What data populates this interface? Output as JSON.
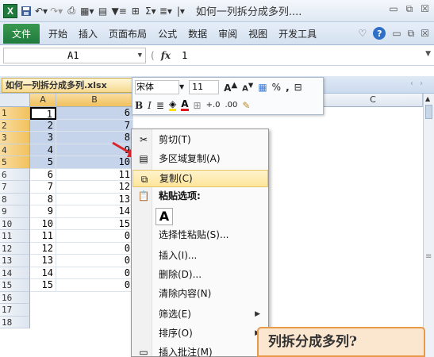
{
  "titlebar": {
    "app_icon": "X",
    "title": "如何一列拆分成多列...."
  },
  "ribbon": {
    "file_tab": "文件",
    "tabs": [
      "开始",
      "插入",
      "页面布局",
      "公式",
      "数据",
      "审阅",
      "视图",
      "开发工具"
    ]
  },
  "formulabar": {
    "namebox": "A1",
    "fx_label": "fx",
    "value": "1"
  },
  "workbook": {
    "tab_name": "如何一列拆分成多列.xlsx"
  },
  "grid": {
    "columns": [
      "A",
      "B",
      "C"
    ],
    "rows": [
      "1",
      "2",
      "3",
      "4",
      "5",
      "6",
      "7",
      "8",
      "9",
      "10",
      "11",
      "12",
      "13",
      "14",
      "15",
      "16",
      "17",
      "18"
    ],
    "col_a": [
      "1",
      "2",
      "3",
      "4",
      "5",
      "6",
      "7",
      "8",
      "9",
      "10",
      "11",
      "12",
      "13",
      "14",
      "15"
    ],
    "col_b": [
      "6",
      "7",
      "8",
      "9",
      "10",
      "11",
      "12",
      "13",
      "14",
      "15",
      "0",
      "0",
      "0",
      "0",
      "0"
    ]
  },
  "mini_toolbar": {
    "font_name": "宋体",
    "font_size": "11",
    "grow": "A",
    "shrink": "A",
    "percent": "%",
    "comma": ",",
    "bold": "B",
    "italic": "I",
    "font_color": "A",
    "inc_decimal": "+.0",
    "dec_decimal": ".00"
  },
  "context_menu": {
    "items": [
      {
        "label": "剪切(T)",
        "icon": "scissors-icon"
      },
      {
        "label": "多区域复制(A)",
        "icon": "multi-copy-icon"
      },
      {
        "label": "复制(C)",
        "icon": "copy-icon"
      },
      {
        "label": "粘贴选项:",
        "icon": "paste-icon"
      },
      {
        "label": "选择性粘贴(S)...",
        "icon": ""
      },
      {
        "label": "插入(I)...",
        "icon": ""
      },
      {
        "label": "删除(D)...",
        "icon": ""
      },
      {
        "label": "清除内容(N)",
        "icon": ""
      },
      {
        "label": "筛选(E)",
        "icon": ""
      },
      {
        "label": "排序(O)",
        "icon": ""
      },
      {
        "label": "插入批注(M)",
        "icon": "comment-icon"
      }
    ],
    "paste_option": "A"
  },
  "banner": {
    "text": "列拆分成多列?"
  },
  "colors": {
    "selection": "#c5d4ea",
    "menu_hover": "#fde59a",
    "excel_green": "#1f7a3d",
    "arrow": "#d9262c"
  }
}
